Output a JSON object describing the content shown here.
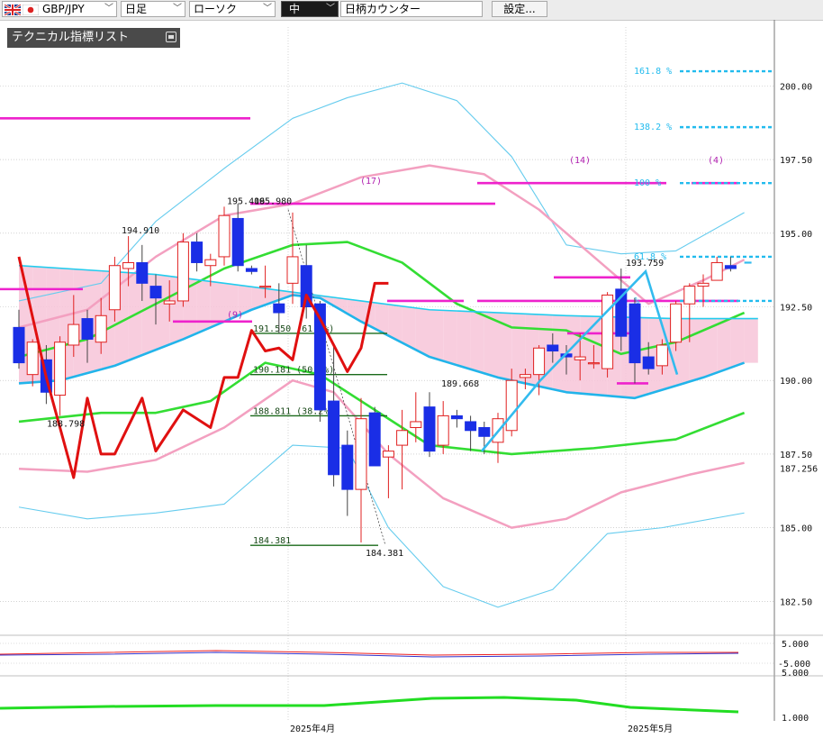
{
  "toolbar": {
    "pair": "GBP/JPY",
    "timeframe": "日足",
    "chart_style": "ローソク",
    "size": "中",
    "counter": "日柄カウンター",
    "settings": "設定..."
  },
  "indicator_list": {
    "label": "テクニカル指標リスト"
  },
  "colors": {
    "bull_fill": "#ffffff",
    "bull_line": "#e02020",
    "bear_fill": "#1a2ee6",
    "bear_line": "#1a2ee6",
    "red_line": "#e01010",
    "green_band": "#33dd33",
    "pink_band": "#f3a0c0",
    "light_blue_band": "#66ccee",
    "cyan_ma": "#22ccee",
    "magenta_line": "#ee22cc",
    "fib_line": "#1a6a1a",
    "kumo_pink": "#f7c4d8",
    "kumo_blue": "#bcdcf4"
  },
  "chart_data": [
    {
      "type": "candlestick",
      "title": "",
      "ylim": [
        181.5,
        202.0
      ],
      "yticks": [
        "200.00",
        "197.50",
        "195.00",
        "192.50",
        "190.00",
        "187.50",
        "185.00",
        "182.50"
      ],
      "current_price_label": "187.256",
      "xlabels": [
        "2025年4月",
        "2025年5月"
      ],
      "candles": [
        {
          "o": 191.8,
          "h": 192.4,
          "l": 190.4,
          "c": 190.6
        },
        {
          "o": 190.2,
          "h": 191.4,
          "l": 189.8,
          "c": 191.3
        },
        {
          "o": 190.7,
          "h": 191.2,
          "l": 189.2,
          "c": 189.6
        },
        {
          "o": 189.5,
          "h": 191.5,
          "l": 188.8,
          "c": 191.3
        },
        {
          "o": 191.2,
          "h": 192.9,
          "l": 190.8,
          "c": 191.9
        },
        {
          "o": 192.1,
          "h": 192.4,
          "l": 190.6,
          "c": 191.4
        },
        {
          "o": 191.3,
          "h": 192.8,
          "l": 190.9,
          "c": 192.2
        },
        {
          "o": 192.4,
          "h": 194.2,
          "l": 192.0,
          "c": 193.9
        },
        {
          "o": 193.8,
          "h": 194.9,
          "l": 193.2,
          "c": 194.0
        },
        {
          "o": 194.0,
          "h": 194.6,
          "l": 192.7,
          "c": 193.3
        },
        {
          "o": 193.2,
          "h": 193.6,
          "l": 191.9,
          "c": 192.8
        },
        {
          "o": 192.6,
          "h": 193.4,
          "l": 192.0,
          "c": 192.7
        },
        {
          "o": 192.7,
          "h": 195.0,
          "l": 192.5,
          "c": 194.7
        },
        {
          "o": 194.7,
          "h": 195.0,
          "l": 193.7,
          "c": 194.0
        },
        {
          "o": 193.9,
          "h": 194.3,
          "l": 193.2,
          "c": 194.1
        },
        {
          "o": 194.2,
          "h": 195.9,
          "l": 193.9,
          "c": 195.6
        },
        {
          "o": 195.5,
          "h": 196.0,
          "l": 193.7,
          "c": 193.9
        },
        {
          "o": 193.8,
          "h": 193.9,
          "l": 193.6,
          "c": 193.7
        },
        {
          "o": 193.2,
          "h": 193.9,
          "l": 192.8,
          "c": 193.2
        },
        {
          "o": 192.6,
          "h": 193.3,
          "l": 191.6,
          "c": 192.3
        },
        {
          "o": 193.3,
          "h": 195.7,
          "l": 192.6,
          "c": 194.2
        },
        {
          "o": 193.9,
          "h": 194.6,
          "l": 192.1,
          "c": 192.5
        },
        {
          "o": 192.6,
          "h": 192.7,
          "l": 188.6,
          "c": 189.0
        },
        {
          "o": 189.3,
          "h": 191.2,
          "l": 186.4,
          "c": 186.8
        },
        {
          "o": 187.8,
          "h": 188.3,
          "l": 185.4,
          "c": 186.3
        },
        {
          "o": 186.3,
          "h": 189.4,
          "l": 184.5,
          "c": 188.7
        },
        {
          "o": 188.9,
          "h": 189.1,
          "l": 187.1,
          "c": 187.1
        },
        {
          "o": 187.4,
          "h": 187.8,
          "l": 186.0,
          "c": 187.6
        },
        {
          "o": 187.8,
          "h": 189.0,
          "l": 186.3,
          "c": 188.3
        },
        {
          "o": 188.4,
          "h": 189.6,
          "l": 187.9,
          "c": 188.6
        },
        {
          "o": 189.1,
          "h": 189.6,
          "l": 187.4,
          "c": 187.6
        },
        {
          "o": 187.8,
          "h": 189.3,
          "l": 187.5,
          "c": 188.8
        },
        {
          "o": 188.8,
          "h": 189.0,
          "l": 188.4,
          "c": 188.7
        },
        {
          "o": 188.6,
          "h": 188.8,
          "l": 187.6,
          "c": 188.3
        },
        {
          "o": 188.4,
          "h": 188.6,
          "l": 187.5,
          "c": 188.1
        },
        {
          "o": 187.9,
          "h": 188.9,
          "l": 187.2,
          "c": 188.7
        },
        {
          "o": 188.3,
          "h": 190.4,
          "l": 188.1,
          "c": 190.0
        },
        {
          "o": 190.1,
          "h": 190.4,
          "l": 189.7,
          "c": 190.2
        },
        {
          "o": 190.2,
          "h": 191.2,
          "l": 189.5,
          "c": 191.1
        },
        {
          "o": 191.2,
          "h": 191.6,
          "l": 190.6,
          "c": 191.0
        },
        {
          "o": 190.9,
          "h": 191.2,
          "l": 190.2,
          "c": 190.8
        },
        {
          "o": 190.7,
          "h": 191.6,
          "l": 190.0,
          "c": 190.8
        },
        {
          "o": 190.6,
          "h": 191.2,
          "l": 190.4,
          "c": 190.6
        },
        {
          "o": 190.4,
          "h": 193.0,
          "l": 190.1,
          "c": 192.9
        },
        {
          "o": 193.1,
          "h": 193.8,
          "l": 191.0,
          "c": 191.5
        },
        {
          "o": 192.6,
          "h": 192.8,
          "l": 189.9,
          "c": 190.6
        },
        {
          "o": 190.8,
          "h": 191.3,
          "l": 190.2,
          "c": 190.4
        },
        {
          "o": 190.5,
          "h": 191.4,
          "l": 190.2,
          "c": 191.2
        },
        {
          "o": 191.3,
          "h": 192.7,
          "l": 191.0,
          "c": 192.6
        },
        {
          "o": 192.6,
          "h": 193.3,
          "l": 191.3,
          "c": 193.2
        },
        {
          "o": 193.2,
          "h": 193.6,
          "l": 192.5,
          "c": 193.3
        },
        {
          "o": 193.4,
          "h": 194.2,
          "l": 193.4,
          "c": 194.0
        },
        {
          "o": 193.9,
          "h": 194.2,
          "l": 193.7,
          "c": 193.8
        }
      ],
      "annotations": [
        {
          "label": "195.406",
          "price": 195.9
        },
        {
          "label": "195.980",
          "price": 195.9
        },
        {
          "label": "194.910",
          "price": 194.9
        },
        {
          "label": "188.798",
          "price": 188.8
        },
        {
          "label": "193.759",
          "price": 193.8
        },
        {
          "label": "189.668",
          "price": 189.7
        },
        {
          "label": "184.381",
          "price": 184.4
        },
        {
          "label": "(17)",
          "price": 196.4
        },
        {
          "label": "(9)",
          "price": 192.5
        },
        {
          "label": "(14)",
          "price": 197.1
        },
        {
          "label": "(4)",
          "price": 197.1
        }
      ],
      "fib_levels": [
        {
          "label": "191.550 (61.8%)",
          "price": 191.6
        },
        {
          "label": "190.181 (50.0%)",
          "price": 190.2
        },
        {
          "label": "188.811 (38.2%)",
          "price": 188.8
        },
        {
          "label": "184.381",
          "price": 184.4
        }
      ],
      "fib_targets": [
        {
          "label": "161.8 %",
          "price": 200.5
        },
        {
          "label": "138.2 %",
          "price": 198.6
        },
        {
          "label": "100 %",
          "price": 196.7
        },
        {
          "label": "61.8 %",
          "price": 194.2
        },
        {
          "label": "%",
          "price": 192.7
        }
      ],
      "series": [
        {
          "name": "",
          "style": "cyan_ma",
          "values": [
            {
              "x": 0,
              "y": 193.9
            },
            {
              "x": 10,
              "y": 193.6
            },
            {
              "x": 15,
              "y": 193.3
            },
            {
              "x": 20,
              "y": 193.0
            },
            {
              "x": 25,
              "y": 192.7
            },
            {
              "x": 30,
              "y": 192.4
            },
            {
              "x": 40,
              "y": 192.2
            },
            {
              "x": 48,
              "y": 192.1
            },
            {
              "x": 54,
              "y": 192.1
            }
          ]
        },
        {
          "name": "",
          "style": "blue_ma",
          "values": [
            {
              "x": 0,
              "y": 189.9
            },
            {
              "x": 3,
              "y": 190.0
            },
            {
              "x": 7,
              "y": 190.5
            },
            {
              "x": 12,
              "y": 191.4
            },
            {
              "x": 17,
              "y": 192.4
            },
            {
              "x": 20,
              "y": 192.9
            },
            {
              "x": 22,
              "y": 192.8
            },
            {
              "x": 25,
              "y": 192.0
            },
            {
              "x": 30,
              "y": 190.8
            },
            {
              "x": 35,
              "y": 190.1
            },
            {
              "x": 40,
              "y": 189.6
            },
            {
              "x": 45,
              "y": 189.4
            },
            {
              "x": 50,
              "y": 190.1
            },
            {
              "x": 53,
              "y": 190.6
            }
          ]
        },
        {
          "name": "",
          "style": "green_mid",
          "values": [
            {
              "x": 0,
              "y": 190.8
            },
            {
              "x": 5,
              "y": 191.4
            },
            {
              "x": 10,
              "y": 192.6
            },
            {
              "x": 15,
              "y": 193.8
            },
            {
              "x": 20,
              "y": 194.6
            },
            {
              "x": 24,
              "y": 194.7
            },
            {
              "x": 28,
              "y": 194.0
            },
            {
              "x": 32,
              "y": 192.6
            },
            {
              "x": 36,
              "y": 191.8
            },
            {
              "x": 40,
              "y": 191.7
            },
            {
              "x": 44,
              "y": 190.9
            },
            {
              "x": 48,
              "y": 191.3
            },
            {
              "x": 53,
              "y": 192.3
            }
          ]
        },
        {
          "name": "",
          "style": "green_low",
          "values": [
            {
              "x": 0,
              "y": 188.6
            },
            {
              "x": 6,
              "y": 188.9
            },
            {
              "x": 10,
              "y": 188.9
            },
            {
              "x": 14,
              "y": 189.3
            },
            {
              "x": 18,
              "y": 190.6
            },
            {
              "x": 22,
              "y": 190.2
            },
            {
              "x": 26,
              "y": 189.0
            },
            {
              "x": 30,
              "y": 187.8
            },
            {
              "x": 36,
              "y": 187.5
            },
            {
              "x": 42,
              "y": 187.7
            },
            {
              "x": 48,
              "y": 188.0
            },
            {
              "x": 53,
              "y": 188.9
            }
          ]
        },
        {
          "name": "",
          "style": "pink_up",
          "values": [
            {
              "x": 0,
              "y": 191.8
            },
            {
              "x": 5,
              "y": 192.4
            },
            {
              "x": 10,
              "y": 194.2
            },
            {
              "x": 15,
              "y": 195.6
            },
            {
              "x": 20,
              "y": 196.0
            },
            {
              "x": 25,
              "y": 196.9
            },
            {
              "x": 30,
              "y": 197.3
            },
            {
              "x": 34,
              "y": 197.0
            },
            {
              "x": 38,
              "y": 195.8
            },
            {
              "x": 42,
              "y": 194.2
            },
            {
              "x": 46,
              "y": 192.6
            },
            {
              "x": 50,
              "y": 193.4
            },
            {
              "x": 53,
              "y": 194.1
            }
          ]
        },
        {
          "name": "",
          "style": "pink_low",
          "values": [
            {
              "x": 0,
              "y": 187.0
            },
            {
              "x": 5,
              "y": 186.9
            },
            {
              "x": 10,
              "y": 187.3
            },
            {
              "x": 15,
              "y": 188.4
            },
            {
              "x": 20,
              "y": 190.0
            },
            {
              "x": 23,
              "y": 189.6
            },
            {
              "x": 27,
              "y": 187.5
            },
            {
              "x": 31,
              "y": 186.0
            },
            {
              "x": 36,
              "y": 185.0
            },
            {
              "x": 40,
              "y": 185.3
            },
            {
              "x": 44,
              "y": 186.2
            },
            {
              "x": 49,
              "y": 186.8
            },
            {
              "x": 53,
              "y": 187.2
            }
          ]
        },
        {
          "name": "",
          "style": "lb_up",
          "values": [
            {
              "x": 0,
              "y": 192.7
            },
            {
              "x": 6,
              "y": 193.3
            },
            {
              "x": 10,
              "y": 195.4
            },
            {
              "x": 15,
              "y": 197.2
            },
            {
              "x": 20,
              "y": 198.9
            },
            {
              "x": 24,
              "y": 199.6
            },
            {
              "x": 28,
              "y": 200.1
            },
            {
              "x": 32,
              "y": 199.5
            },
            {
              "x": 36,
              "y": 197.6
            },
            {
              "x": 40,
              "y": 194.6
            },
            {
              "x": 44,
              "y": 194.3
            },
            {
              "x": 48,
              "y": 194.4
            },
            {
              "x": 53,
              "y": 195.7
            }
          ]
        },
        {
          "name": "",
          "style": "lb_low",
          "values": [
            {
              "x": 0,
              "y": 185.7
            },
            {
              "x": 5,
              "y": 185.3
            },
            {
              "x": 10,
              "y": 185.5
            },
            {
              "x": 15,
              "y": 185.8
            },
            {
              "x": 20,
              "y": 187.8
            },
            {
              "x": 24,
              "y": 187.7
            },
            {
              "x": 27,
              "y": 185.0
            },
            {
              "x": 31,
              "y": 183.0
            },
            {
              "x": 35,
              "y": 182.3
            },
            {
              "x": 39,
              "y": 182.9
            },
            {
              "x": 43,
              "y": 184.8
            },
            {
              "x": 47,
              "y": 185.0
            },
            {
              "x": 53,
              "y": 185.5
            }
          ]
        },
        {
          "name": "",
          "style": "red_line",
          "values": [
            {
              "x": 0,
              "y": 194.2
            },
            {
              "x": 2,
              "y": 190.1
            },
            {
              "x": 4,
              "y": 186.7
            },
            {
              "x": 5,
              "y": 189.4
            },
            {
              "x": 6,
              "y": 187.5
            },
            {
              "x": 7,
              "y": 187.5
            },
            {
              "x": 9,
              "y": 189.4
            },
            {
              "x": 10,
              "y": 187.6
            },
            {
              "x": 12,
              "y": 189.0
            },
            {
              "x": 14,
              "y": 188.4
            },
            {
              "x": 15,
              "y": 190.1
            },
            {
              "x": 16,
              "y": 190.1
            },
            {
              "x": 17,
              "y": 191.7
            },
            {
              "x": 18,
              "y": 191.0
            },
            {
              "x": 19,
              "y": 191.1
            },
            {
              "x": 20,
              "y": 190.7
            },
            {
              "x": 21,
              "y": 192.9
            },
            {
              "x": 22,
              "y": 192.1
            },
            {
              "x": 23,
              "y": 191.2
            },
            {
              "x": 24,
              "y": 190.3
            },
            {
              "x": 25,
              "y": 191.1
            },
            {
              "x": 26,
              "y": 193.3
            },
            {
              "x": 27,
              "y": 193.3
            }
          ]
        }
      ]
    },
    {
      "type": "line",
      "title": "",
      "yticks": [
        "5.000",
        "-5.000"
      ],
      "ylim": [
        -7,
        7
      ]
    },
    {
      "type": "line",
      "title": "",
      "yticks": [
        "5.000",
        "1.000"
      ],
      "ylim": [
        0,
        5.2
      ]
    }
  ]
}
